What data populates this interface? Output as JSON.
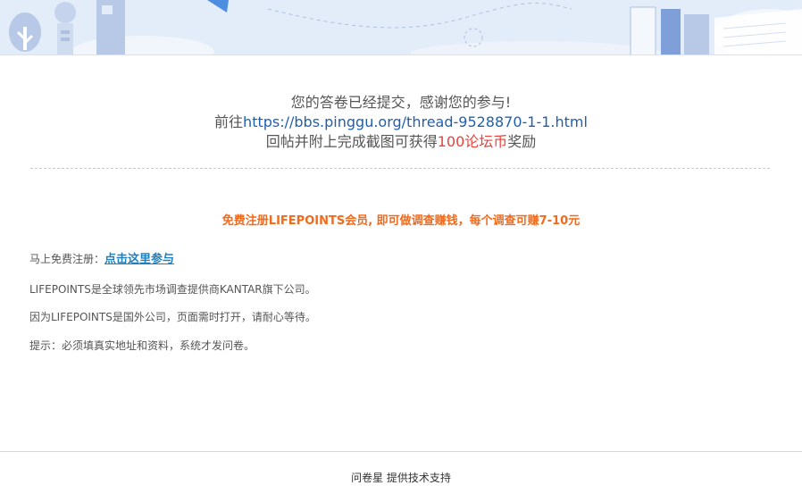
{
  "thanks": {
    "line1": "您的答卷已经提交，感谢您的参与!",
    "line2_prefix": "前往",
    "line2_link": "https://bbs.pinggu.org/thread-9528870-1-1.html",
    "line3_prefix": "回帖并附上完成截图可获得",
    "line3_reward": "100论坛币",
    "line3_suffix": "奖励"
  },
  "promo": {
    "text": "免费注册LIFEPOINTS会员, 即可做调查赚钱，每个调查可赚7-10元"
  },
  "info": {
    "register_label": "马上免费注册：",
    "register_link": "点击这里参与",
    "line2": "LIFEPOINTS是全球领先市场调查提供商KANTAR旗下公司。",
    "line3": "因为LIFEPOINTS是国外公司，页面需时打开，请耐心等待。",
    "line4": "提示：必须填真实地址和资料，系统才发问卷。"
  },
  "footer": {
    "brand": "问卷星",
    "text": " 提供技术支持"
  },
  "colors": {
    "link": "#1f5fb0",
    "reward": "#e8423b",
    "promo": "#f26a1b",
    "banner": "#e3ecf9"
  }
}
